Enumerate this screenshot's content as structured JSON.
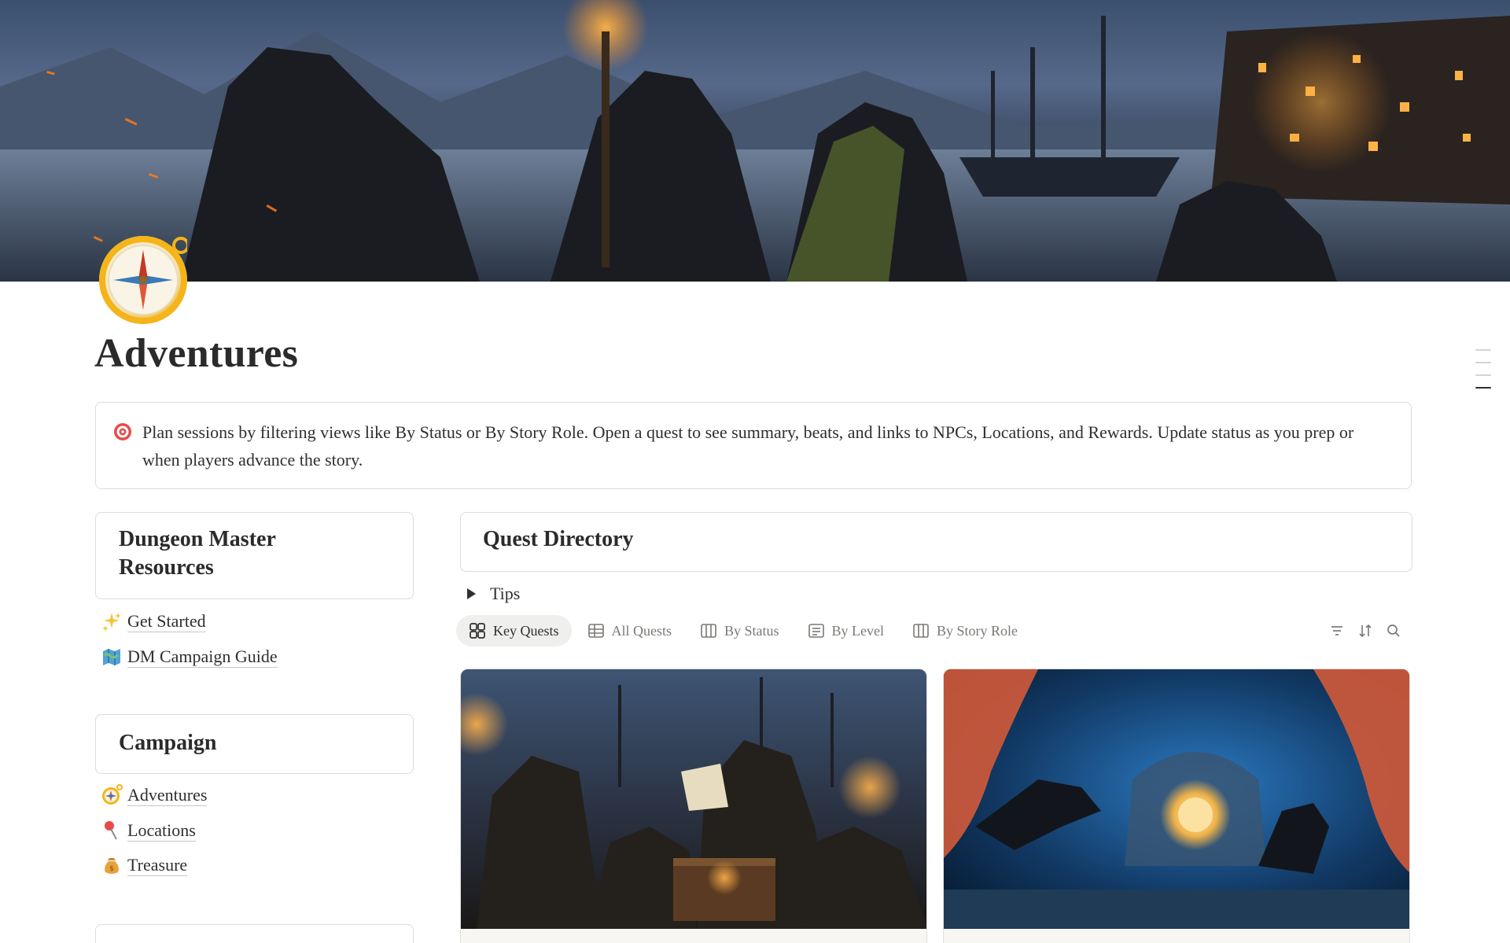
{
  "page": {
    "title": "Adventures",
    "callout_text": "Plan sessions by filtering views like By Status or By Story Role. Open a quest to see summary, beats, and links to NPCs, Locations, and Rewards. Update status as you prep or when players advance the story.",
    "callout_icon": "target-icon",
    "page_icon": "compass-icon"
  },
  "sidebar": {
    "sections": [
      {
        "heading": "Dungeon Master Resources",
        "links": [
          {
            "label": "Get Started",
            "icon": "sparkles-icon"
          },
          {
            "label": "DM Campaign Guide",
            "icon": "map-icon"
          }
        ]
      },
      {
        "heading": "Campaign",
        "links": [
          {
            "label": "Adventures",
            "icon": "compass-icon"
          },
          {
            "label": "Locations",
            "icon": "pin-icon"
          },
          {
            "label": "Treasure",
            "icon": "money-bag-icon"
          }
        ]
      }
    ]
  },
  "directory": {
    "heading": "Quest Directory",
    "tips_label": "Tips",
    "tabs": [
      {
        "label": "Key Quests",
        "icon": "gallery-icon",
        "active": true
      },
      {
        "label": "All Quests",
        "icon": "table-icon",
        "active": false
      },
      {
        "label": "By Status",
        "icon": "board-icon",
        "active": false
      },
      {
        "label": "By Level",
        "icon": "list-icon",
        "active": false
      },
      {
        "label": "By Story Role",
        "icon": "board-icon",
        "active": false
      }
    ],
    "tools": [
      "filter-icon",
      "sort-icon",
      "search-icon"
    ]
  },
  "colors": {
    "text": "#2f2f2f",
    "muted": "#7a7874",
    "border": "#dedcd7",
    "active_tab": "#efefed",
    "icon_gold": "#f4b41a"
  }
}
